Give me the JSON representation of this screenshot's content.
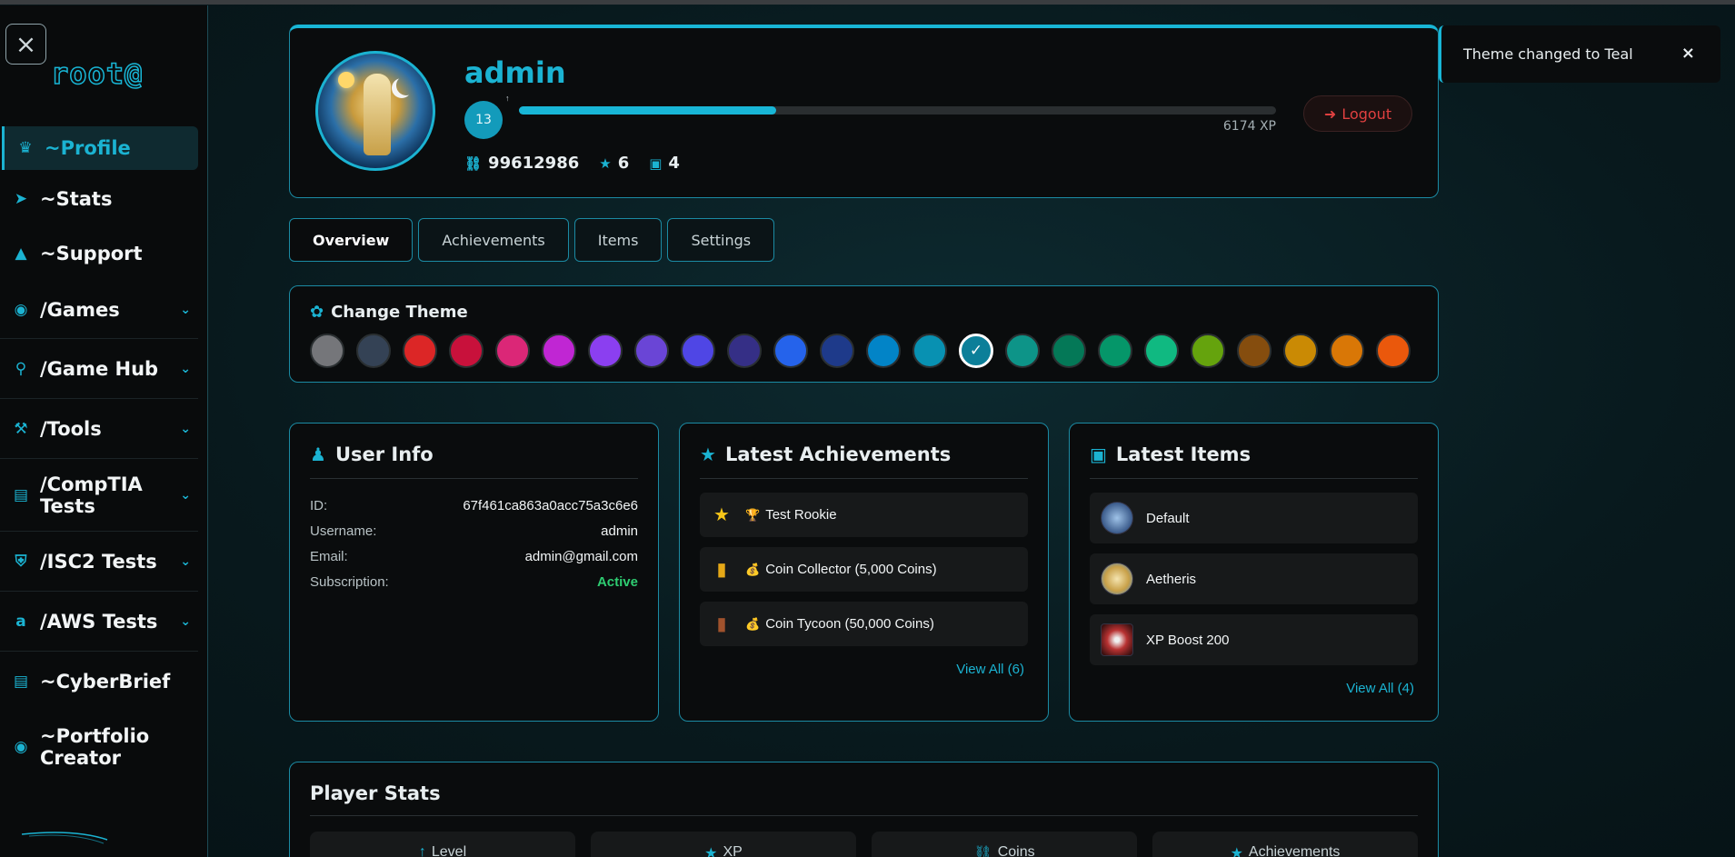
{
  "sidebar": {
    "close_icon": "close-icon",
    "brand": "root@",
    "items": [
      {
        "label": "~Profile",
        "icon": "profile-icon",
        "active": true,
        "expandable": false
      },
      {
        "label": "~Stats",
        "icon": "raven-icon",
        "active": false,
        "expandable": false
      },
      {
        "label": "~Support",
        "icon": "wizard-icon",
        "active": false,
        "expandable": false
      },
      {
        "label": "/Games",
        "icon": "gamepad-icon",
        "active": false,
        "expandable": true
      },
      {
        "label": "/Game Hub",
        "icon": "award-icon",
        "active": false,
        "expandable": true
      },
      {
        "label": "/Tools",
        "icon": "tools-icon",
        "active": false,
        "expandable": true
      },
      {
        "label": "/CompTIA Tests",
        "icon": "laptop-icon",
        "active": false,
        "expandable": true
      },
      {
        "label": "/ISC2 Tests",
        "icon": "shield-icon",
        "active": false,
        "expandable": true
      },
      {
        "label": "/AWS Tests",
        "icon": "amazon-icon",
        "active": false,
        "expandable": true
      },
      {
        "label": "~CyberBrief",
        "icon": "newspaper-icon",
        "active": false,
        "expandable": false
      },
      {
        "label": "~Portfolio Creator",
        "icon": "github-icon",
        "active": false,
        "expandable": false
      }
    ]
  },
  "profile": {
    "username": "admin",
    "level": "13",
    "level_caret": "↑",
    "xp_progress": 0.34,
    "xp_text": "6174 XP",
    "coins": "99612986",
    "achievements_count": "6",
    "items_count": "4",
    "logout_label": "Logout"
  },
  "tabs": [
    {
      "label": "Overview",
      "active": true
    },
    {
      "label": "Achievements",
      "active": false
    },
    {
      "label": "Items",
      "active": false
    },
    {
      "label": "Settings",
      "active": false
    }
  ],
  "theme": {
    "title": "Change Theme",
    "swatches": [
      "#75767a",
      "#344255",
      "#dc2626",
      "#c8113b",
      "#db2777",
      "#c026d3",
      "#8b3ff0",
      "#6a45d6",
      "#4f46e5",
      "#352f86",
      "#2563eb",
      "#1e3a8a",
      "#0284c7",
      "#0891b2",
      "#0c7f99",
      "#0d9488",
      "#047857",
      "#059669",
      "#10b981",
      "#65a30d",
      "#854d0e",
      "#ca8a04",
      "#d97706",
      "#ea580c"
    ],
    "selected_index": 14
  },
  "user_info": {
    "title": "User Info",
    "rows": [
      {
        "key": "ID:",
        "value": "67f461ca863a0acc75a3c6e6"
      },
      {
        "key": "Username:",
        "value": "admin"
      },
      {
        "key": "Email:",
        "value": "admin@gmail.com"
      },
      {
        "key": "Subscription:",
        "value": "Active"
      }
    ]
  },
  "latest_achievements": {
    "title": "Latest Achievements",
    "items": [
      {
        "icon": "trophy-icon",
        "emoji": "🏆",
        "label": "Test Rookie",
        "color": "#f5c518"
      },
      {
        "icon": "book-icon",
        "emoji": "💰",
        "label": "Coin Collector (5,000 Coins)",
        "color": "#e6a817"
      },
      {
        "icon": "book-icon",
        "emoji": "💰",
        "label": "Coin Tycoon (50,000 Coins)",
        "color": "#a0522d"
      }
    ],
    "view_all": "View All (6)"
  },
  "latest_items": {
    "title": "Latest Items",
    "items": [
      {
        "label": "Default",
        "thumb_color": "#3a5a8a"
      },
      {
        "label": "Aetheris",
        "thumb_color": "#c8a048"
      },
      {
        "label": "XP Boost 200",
        "thumb_color": "#b83232"
      }
    ],
    "view_all": "View All (4)"
  },
  "player_stats": {
    "title": "Player Stats",
    "tiles": [
      {
        "icon": "arrow-up-icon",
        "label": "Level"
      },
      {
        "icon": "star-icon",
        "label": "XP"
      },
      {
        "icon": "coins-icon",
        "label": "Coins"
      },
      {
        "icon": "trophy-icon",
        "label": "Achievements"
      }
    ]
  },
  "toast": {
    "message": "Theme changed to Teal",
    "close": "×"
  }
}
